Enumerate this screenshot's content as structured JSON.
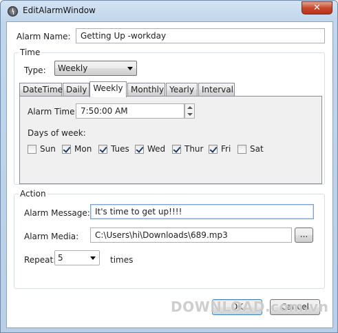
{
  "window": {
    "title": "EditAlarmWindow",
    "close_glyph": "✕",
    "app_icon": "alarm-clock-icon"
  },
  "alarm_name": {
    "label": "Alarm Name:",
    "value": "Getting Up -workday"
  },
  "time_group": {
    "title": "Time",
    "type_label": "Type:",
    "type_value": "Weekly",
    "tabs": [
      "DateTime",
      "Daily",
      "Weekly",
      "Monthly",
      "Yearly",
      "Interval"
    ],
    "active_tab": "Weekly",
    "alarm_time_label": "Alarm Time:",
    "alarm_time_value": "7:50:00 AM",
    "days_label": "Days of week:",
    "days": [
      {
        "label": "Sun",
        "checked": false
      },
      {
        "label": "Mon",
        "checked": true
      },
      {
        "label": "Tues",
        "checked": true
      },
      {
        "label": "Wed",
        "checked": true
      },
      {
        "label": "Thur",
        "checked": true
      },
      {
        "label": "Fri",
        "checked": true
      },
      {
        "label": "Sat",
        "checked": false
      }
    ]
  },
  "action_group": {
    "title": "Action",
    "message_label": "Alarm Message:",
    "message_value": "It's time to get up!!!!",
    "media_label": "Alarm Media:",
    "media_value": "C:\\Users\\hi\\Downloads\\689.mp3",
    "browse_label": "...",
    "repeat_label": "Repeat:",
    "repeat_value": "5",
    "repeat_suffix": "times"
  },
  "buttons": {
    "ok": "OK",
    "cancel": "Cancel"
  },
  "watermark": "DOWNLOAD.com.vn"
}
